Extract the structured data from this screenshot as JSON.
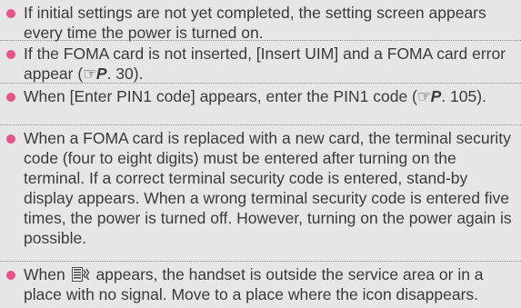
{
  "notes": [
    {
      "text": "If initial settings are not yet completed, the setting screen appears every time the power is turned on."
    },
    {
      "text_before": "If the FOMA card is not inserted, [Insert UIM] and a FOMA card error appear (",
      "ref_symbol": "☞",
      "ref_letter": "P",
      "ref_page": ". 30",
      "text_after": ")."
    },
    {
      "text_before": "When [Enter PIN1 code] appears, enter the PIN1 code (",
      "ref_symbol": "☞",
      "ref_letter": "P",
      "ref_page": ". 105",
      "text_after": ")."
    },
    {
      "text": "When a FOMA card is replaced with a new card, the terminal security code (four to eight digits) must be entered after turning on the terminal. If a correct terminal security code is entered, stand-by display appears. When a wrong terminal security code is entered five times, the power is turned off. However, turning on the power again is possible."
    },
    {
      "text_before": "When ",
      "icon": "no-signal-icon",
      "text_after": " appears, the handset is outside the service area or in a place with no signal. Move to a place where the icon disappears."
    }
  ],
  "colors": {
    "background": "#e6e6e6",
    "bullet": "#e8528b",
    "text": "#3b3b3b"
  }
}
